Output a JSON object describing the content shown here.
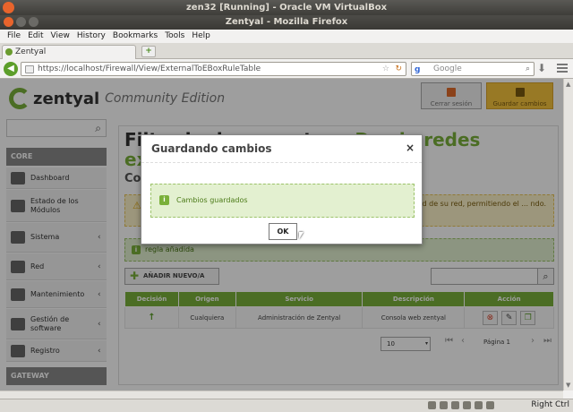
{
  "vbox": {
    "title": "zen32 [Running] - Oracle VM VirtualBox",
    "host_key": "Right Ctrl"
  },
  "firefox": {
    "title": "Zentyal - Mozilla Firefox",
    "menu": [
      "File",
      "Edit",
      "View",
      "History",
      "Bookmarks",
      "Tools",
      "Help"
    ],
    "tab_label": "Zentyal",
    "url": "https://localhost/Firewall/View/ExternalToEBoxRuleTable",
    "search_placeholder": "Google",
    "search_engine_letter": "g"
  },
  "header": {
    "brand": "zentyal",
    "edition": "Community Edition",
    "logout_label": "Cerrar sesión",
    "save_label": "Guardar cambios"
  },
  "sidebar": {
    "core_label": "CORE",
    "items": [
      {
        "label": "Dashboard",
        "chevron": ""
      },
      {
        "label": "Estado de los Módulos",
        "chevron": ""
      },
      {
        "label": "Sistema",
        "chevron": "‹"
      },
      {
        "label": "Red",
        "chevron": "‹"
      },
      {
        "label": "Mantenimiento",
        "chevron": "‹"
      },
      {
        "label": "Gestión de software",
        "chevron": "‹"
      },
      {
        "label": "Registro",
        "chevron": "‹"
      }
    ],
    "gateway_label": "GATEWAY"
  },
  "main": {
    "title_dark": "Filtrado de paquetes",
    "title_sep": "›",
    "title_green": "Desde redes externas ha",
    "subtitle": "Co",
    "warning": "seguridad de su red, permitiendo el ... ndo.",
    "success": "regla añadida",
    "add_label": "AÑADIR NUEVO/A",
    "columns": [
      "Decisión",
      "Origen",
      "Servicio",
      "Descripción",
      "Acción"
    ],
    "rows": [
      {
        "decision": "↑",
        "origin": "Cualquiera",
        "service": "Administración de Zentyal",
        "description": "Consola web zentyal"
      }
    ],
    "page_size": "10",
    "page_label": "Página 1"
  },
  "dialog": {
    "title": "Guardando cambios",
    "message": "Cambios guardados",
    "ok_label": "OK",
    "close_glyph": "×"
  },
  "colors": {
    "brand_green": "#7ab03a",
    "save_yellow": "#f5c33c",
    "overlay": "rgba(0,0,0,0.38)"
  }
}
